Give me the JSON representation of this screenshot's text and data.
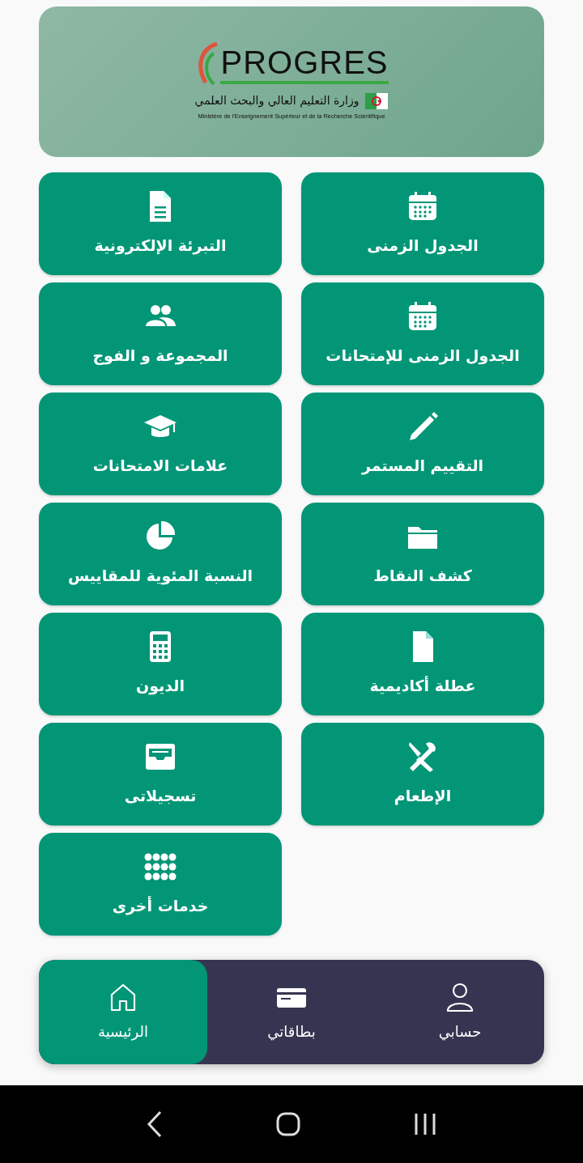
{
  "header": {
    "logo_text": "PROGRES",
    "ministry_ar": "وزارة التعليم العالي والبحث العلمي",
    "ministry_fr": "Ministère de l'Enseignement Supérieur et de la Recherche Scientifique"
  },
  "tiles": [
    {
      "label": "الجدول الزمنى"
    },
    {
      "label": "التبرئة الإلكترونية"
    },
    {
      "label": "الجدول الزمنى للإمتحانات"
    },
    {
      "label": "المجموعة و الفوج"
    },
    {
      "label": "التقييم المستمر"
    },
    {
      "label": "علامات الامتحانات"
    },
    {
      "label": "كشف النقاط"
    },
    {
      "label": "النسبة المئوية للمقاييس"
    },
    {
      "label": "عطلة أكاديمية"
    },
    {
      "label": "الديون"
    },
    {
      "label": "الإطعام"
    },
    {
      "label": "تسجيلاتى"
    },
    {
      "label": "خدمات أخرى"
    }
  ],
  "bottom_nav": [
    {
      "label": "حسابي",
      "selected": false
    },
    {
      "label": "بطاقاتي",
      "selected": false
    },
    {
      "label": "الرئيسية",
      "selected": true
    }
  ]
}
